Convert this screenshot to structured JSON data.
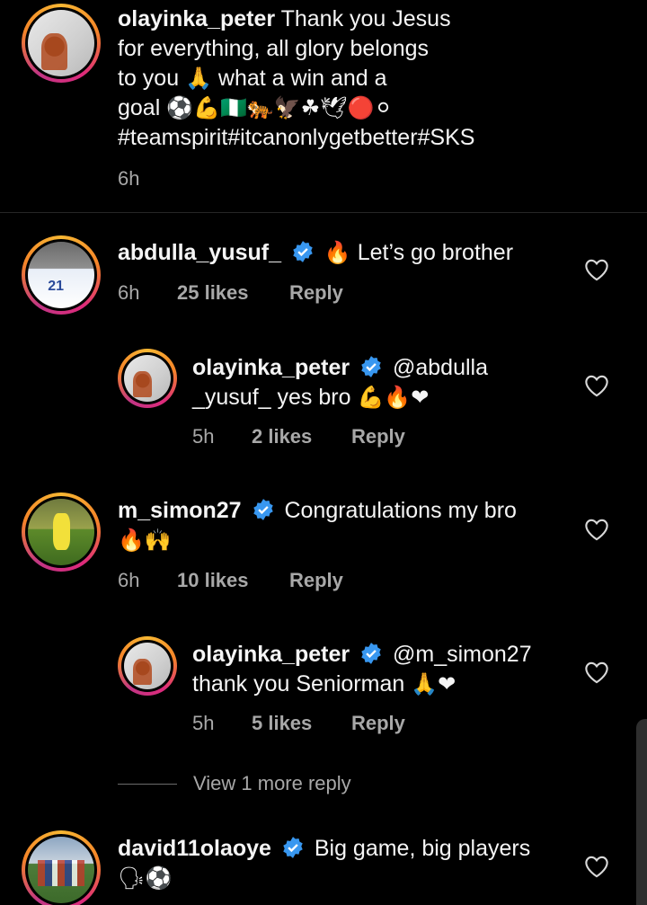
{
  "caption": {
    "username": "olayinka_peter",
    "line1": "Thank you Jesus",
    "line2": "for everything, all glory belongs",
    "line3a": "to you",
    "line3b": "what a win and a",
    "line4": "goal",
    "emoji_line4": "⚽💪🇳🇬🐅🦅☘🕊🔴⚪",
    "hashtags": "#teamspirit#itcanonlygetbetter#SKS",
    "time": "6h"
  },
  "comments": [
    {
      "username": "abdulla_yusuf_",
      "text": "Let’s go brother",
      "emoji_prefix": "🔥",
      "time": "6h",
      "likes": "25 likes",
      "reply": "Reply"
    },
    {
      "username": "olayinka_peter",
      "text_line1": "@abdulla",
      "text_line2": "_yusuf_ yes bro",
      "emoji": "💪🔥❤",
      "time": "5h",
      "likes": "2 likes",
      "reply": "Reply"
    },
    {
      "username": "m_simon27",
      "text": "Congratulations my bro",
      "emoji": "🔥🙌",
      "time": "6h",
      "likes": "10 likes",
      "reply": "Reply"
    },
    {
      "username": "olayinka_peter",
      "text_line1": "@m_simon27",
      "text_line2": "thank you Seniorman",
      "emoji": "🙏❤",
      "time": "5h",
      "likes": "5 likes",
      "reply": "Reply"
    },
    {
      "username": "david11olaoye",
      "text": "Big game, big players",
      "emoji": "🗣⚽"
    }
  ],
  "view_more": "View 1 more reply",
  "colors": {
    "background": "#000000",
    "meta": "#a8a8a8",
    "verified": "#3897f0"
  },
  "icons": {
    "verified": "verified-badge-icon",
    "like": "heart-outline-icon",
    "pray": "praying-hands-emoji"
  }
}
